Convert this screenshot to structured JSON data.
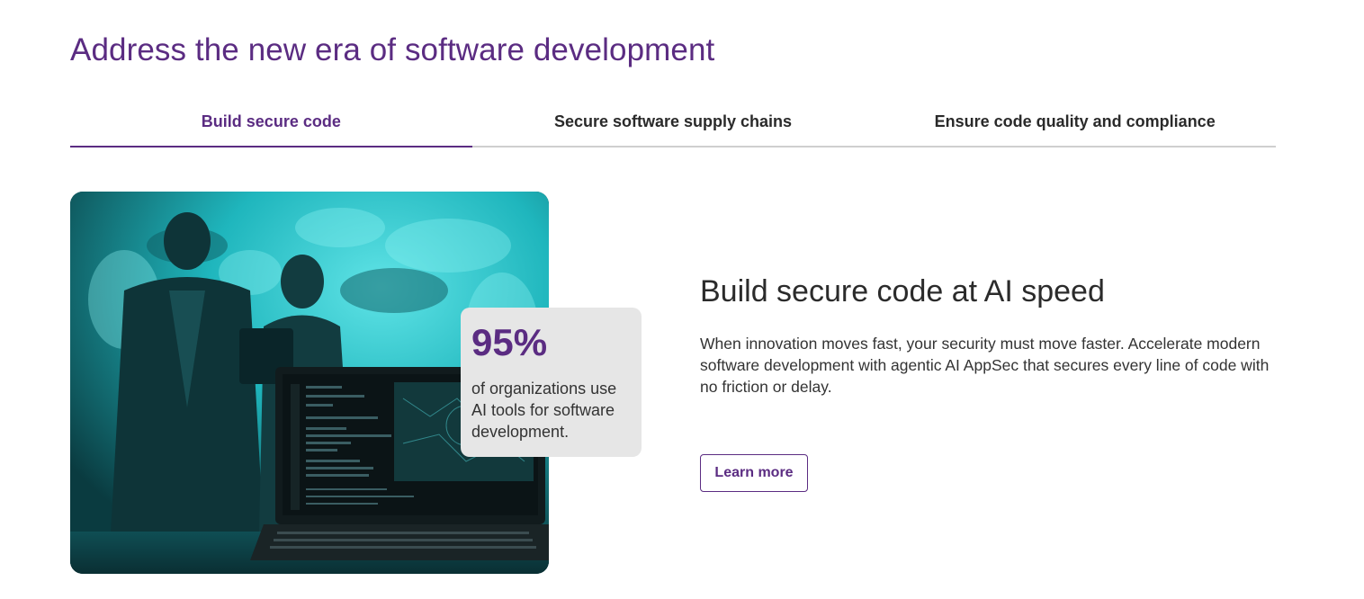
{
  "section": {
    "heading": "Address the new era of software development"
  },
  "tabs": [
    {
      "label": "Build secure code",
      "active": true
    },
    {
      "label": "Secure software supply chains",
      "active": false
    },
    {
      "label": "Ensure code quality and compliance",
      "active": false
    }
  ],
  "stat": {
    "value": "95%",
    "caption": "of organizations use AI tools for software development."
  },
  "panel": {
    "title": "Build secure code at AI speed",
    "body": "When innovation moves fast, your security must move faster. Accelerate modern software development with agentic AI AppSec that secures every line of code with no friction or delay.",
    "cta_label": "Learn more"
  },
  "colors": {
    "accent": "#5b2c82",
    "tab_divider": "#cfcfcf",
    "image_tint": "#1fb6bd",
    "card_bg": "#e6e6e6"
  }
}
